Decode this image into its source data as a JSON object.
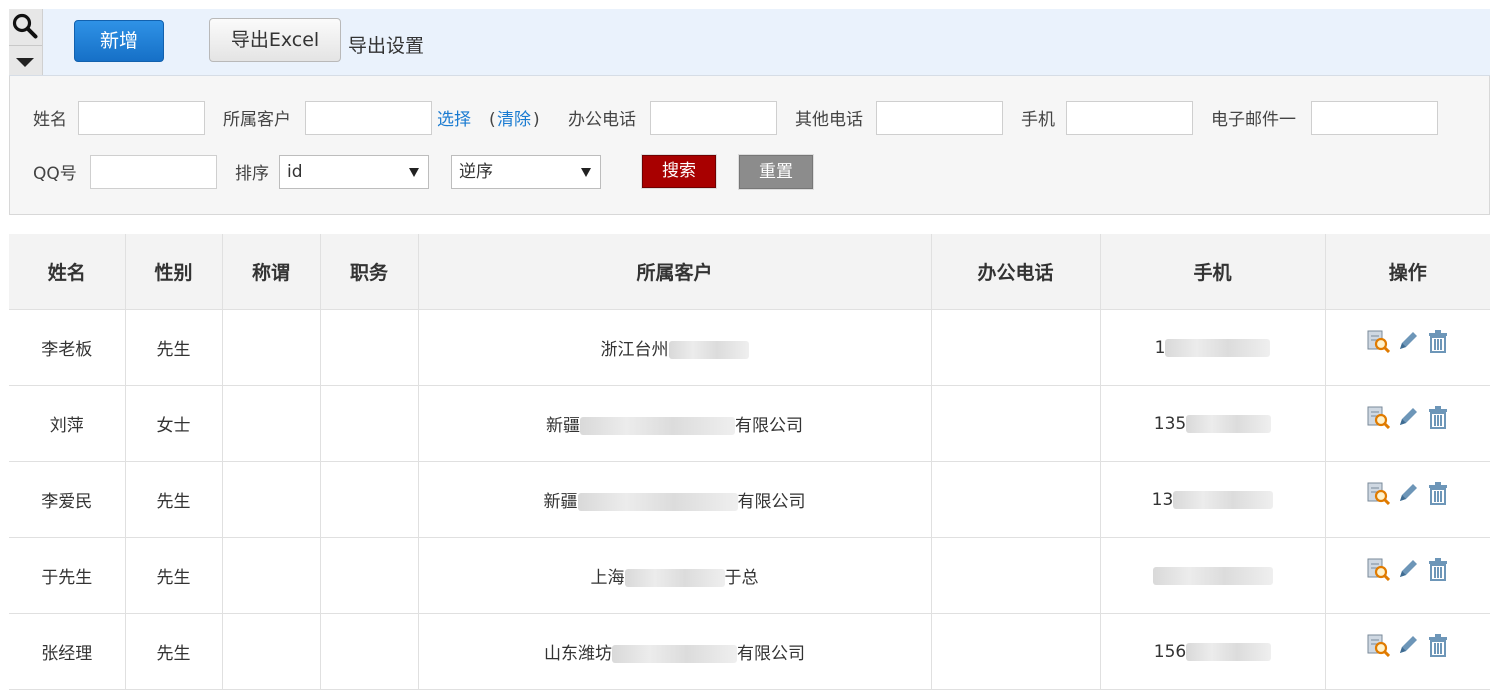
{
  "toolbar": {
    "add_label": "新增",
    "export_label": "导出Excel",
    "export_settings_label": "导出设置"
  },
  "filter": {
    "name_label": "姓名",
    "customer_label": "所属客户",
    "select_link": "选择",
    "paren_open": "(",
    "clear_link": "清除",
    "paren_close": ")",
    "office_phone_label": "办公电话",
    "other_phone_label": "其他电话",
    "mobile_label": "手机",
    "email_label": "电子邮件一",
    "qq_label": "QQ号",
    "sort_label": "排序",
    "sort_field_value": "id",
    "sort_order_value": "逆序",
    "search_label": "搜索",
    "reset_label": "重置"
  },
  "table": {
    "headers": [
      "姓名",
      "性别",
      "称谓",
      "职务",
      "所属客户",
      "办公电话",
      "手机",
      "操作"
    ],
    "rows": [
      {
        "name": "李老板",
        "gender": "先生",
        "title": "",
        "position": "",
        "customer_prefix": "浙江台州",
        "customer_suffix": "",
        "office_phone": "",
        "mobile_prefix": "1"
      },
      {
        "name": "刘萍",
        "gender": "女士",
        "title": "",
        "position": "",
        "customer_prefix": "新疆",
        "customer_suffix": "有限公司",
        "office_phone": "",
        "mobile_prefix": "135"
      },
      {
        "name": "李爱民",
        "gender": "先生",
        "title": "",
        "position": "",
        "customer_prefix": "新疆",
        "customer_suffix": "有限公司",
        "office_phone": "",
        "mobile_prefix": "13"
      },
      {
        "name": "于先生",
        "gender": "先生",
        "title": "",
        "position": "",
        "customer_prefix": "上海",
        "customer_suffix": "于总",
        "office_phone": "",
        "mobile_prefix": ""
      },
      {
        "name": "张经理",
        "gender": "先生",
        "title": "",
        "position": "",
        "customer_prefix": "山东潍坊",
        "customer_suffix": "有限公司",
        "office_phone": "",
        "mobile_prefix": "156"
      }
    ],
    "row_actions": [
      "view-icon",
      "edit-icon",
      "delete-icon"
    ]
  },
  "colors": {
    "add_button": "#1670c7",
    "search_button": "#a80000",
    "reset_button": "#8c8c8c",
    "link": "#1a7bd1",
    "toolbar_bg": "#eaf2fc"
  }
}
